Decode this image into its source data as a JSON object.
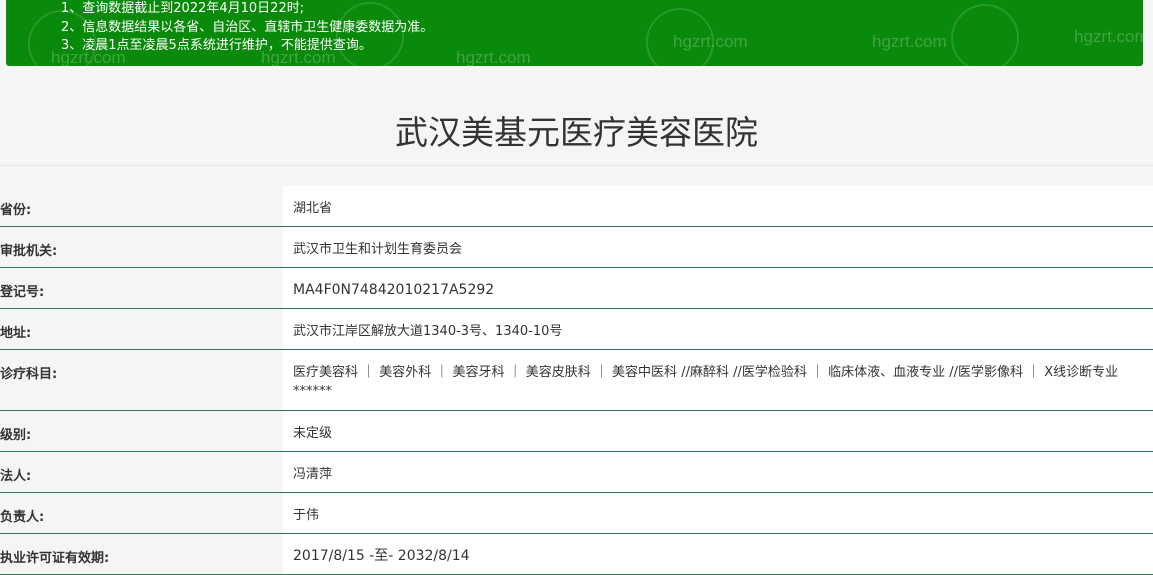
{
  "notice": {
    "items": [
      "1、查询数据截止到2022年4月10日22时;",
      "2、信息数据结果以各省、自治区、直辖市卫生健康委数据为准。",
      "3、凌晨1点至凌晨5点系统进行维护，不能提供查询。"
    ],
    "watermark": "hgzrt.com"
  },
  "page": {
    "title": "武汉美基元医疗美容医院"
  },
  "details": {
    "rows": [
      {
        "label": "省份:",
        "value": "湖北省"
      },
      {
        "label": "审批机关:",
        "value": "武汉市卫生和计划生育委员会"
      },
      {
        "label": "登记号:",
        "value": "MA4F0N74842010217A5292"
      },
      {
        "label": "地址:",
        "value": "武汉市江岸区解放大道1340-3号、1340-10号"
      },
      {
        "label": "诊疗科目:",
        "value": "医疗美容科 ｜ 美容外科 ｜ 美容牙科 ｜ 美容皮肤科 ｜ 美容中医科 //麻醉科 //医学检验科 ｜ 临床体液、血液专业 //医学影像科 ｜ X线诊断专业******"
      },
      {
        "label": "级别:",
        "value": "未定级"
      },
      {
        "label": "法人:",
        "value": "冯清萍"
      },
      {
        "label": "负责人:",
        "value": "于伟"
      },
      {
        "label": "执业许可证有效期:",
        "value": "2017/8/15 -至- 2032/8/14"
      }
    ]
  },
  "colors": {
    "notice_bg": "#0a8a0a",
    "row_border": "#2f7a52",
    "label_bg": "#f5f5f5",
    "value_bg": "#ffffff"
  }
}
